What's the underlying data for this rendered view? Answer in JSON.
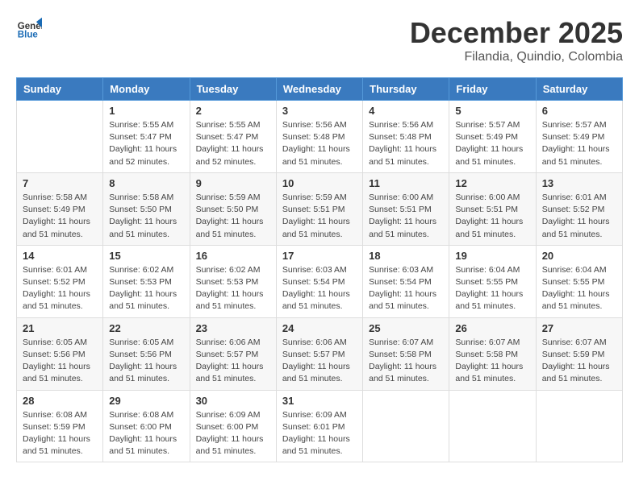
{
  "header": {
    "logo_general": "General",
    "logo_blue": "Blue",
    "month_title": "December 2025",
    "location": "Filandia, Quindio, Colombia"
  },
  "weekdays": [
    "Sunday",
    "Monday",
    "Tuesday",
    "Wednesday",
    "Thursday",
    "Friday",
    "Saturday"
  ],
  "weeks": [
    [
      {
        "day": "",
        "sunrise": "",
        "sunset": "",
        "daylight": ""
      },
      {
        "day": "1",
        "sunrise": "Sunrise: 5:55 AM",
        "sunset": "Sunset: 5:47 PM",
        "daylight": "Daylight: 11 hours and 52 minutes."
      },
      {
        "day": "2",
        "sunrise": "Sunrise: 5:55 AM",
        "sunset": "Sunset: 5:47 PM",
        "daylight": "Daylight: 11 hours and 52 minutes."
      },
      {
        "day": "3",
        "sunrise": "Sunrise: 5:56 AM",
        "sunset": "Sunset: 5:48 PM",
        "daylight": "Daylight: 11 hours and 51 minutes."
      },
      {
        "day": "4",
        "sunrise": "Sunrise: 5:56 AM",
        "sunset": "Sunset: 5:48 PM",
        "daylight": "Daylight: 11 hours and 51 minutes."
      },
      {
        "day": "5",
        "sunrise": "Sunrise: 5:57 AM",
        "sunset": "Sunset: 5:49 PM",
        "daylight": "Daylight: 11 hours and 51 minutes."
      },
      {
        "day": "6",
        "sunrise": "Sunrise: 5:57 AM",
        "sunset": "Sunset: 5:49 PM",
        "daylight": "Daylight: 11 hours and 51 minutes."
      }
    ],
    [
      {
        "day": "7",
        "sunrise": "Sunrise: 5:58 AM",
        "sunset": "Sunset: 5:49 PM",
        "daylight": "Daylight: 11 hours and 51 minutes."
      },
      {
        "day": "8",
        "sunrise": "Sunrise: 5:58 AM",
        "sunset": "Sunset: 5:50 PM",
        "daylight": "Daylight: 11 hours and 51 minutes."
      },
      {
        "day": "9",
        "sunrise": "Sunrise: 5:59 AM",
        "sunset": "Sunset: 5:50 PM",
        "daylight": "Daylight: 11 hours and 51 minutes."
      },
      {
        "day": "10",
        "sunrise": "Sunrise: 5:59 AM",
        "sunset": "Sunset: 5:51 PM",
        "daylight": "Daylight: 11 hours and 51 minutes."
      },
      {
        "day": "11",
        "sunrise": "Sunrise: 6:00 AM",
        "sunset": "Sunset: 5:51 PM",
        "daylight": "Daylight: 11 hours and 51 minutes."
      },
      {
        "day": "12",
        "sunrise": "Sunrise: 6:00 AM",
        "sunset": "Sunset: 5:51 PM",
        "daylight": "Daylight: 11 hours and 51 minutes."
      },
      {
        "day": "13",
        "sunrise": "Sunrise: 6:01 AM",
        "sunset": "Sunset: 5:52 PM",
        "daylight": "Daylight: 11 hours and 51 minutes."
      }
    ],
    [
      {
        "day": "14",
        "sunrise": "Sunrise: 6:01 AM",
        "sunset": "Sunset: 5:52 PM",
        "daylight": "Daylight: 11 hours and 51 minutes."
      },
      {
        "day": "15",
        "sunrise": "Sunrise: 6:02 AM",
        "sunset": "Sunset: 5:53 PM",
        "daylight": "Daylight: 11 hours and 51 minutes."
      },
      {
        "day": "16",
        "sunrise": "Sunrise: 6:02 AM",
        "sunset": "Sunset: 5:53 PM",
        "daylight": "Daylight: 11 hours and 51 minutes."
      },
      {
        "day": "17",
        "sunrise": "Sunrise: 6:03 AM",
        "sunset": "Sunset: 5:54 PM",
        "daylight": "Daylight: 11 hours and 51 minutes."
      },
      {
        "day": "18",
        "sunrise": "Sunrise: 6:03 AM",
        "sunset": "Sunset: 5:54 PM",
        "daylight": "Daylight: 11 hours and 51 minutes."
      },
      {
        "day": "19",
        "sunrise": "Sunrise: 6:04 AM",
        "sunset": "Sunset: 5:55 PM",
        "daylight": "Daylight: 11 hours and 51 minutes."
      },
      {
        "day": "20",
        "sunrise": "Sunrise: 6:04 AM",
        "sunset": "Sunset: 5:55 PM",
        "daylight": "Daylight: 11 hours and 51 minutes."
      }
    ],
    [
      {
        "day": "21",
        "sunrise": "Sunrise: 6:05 AM",
        "sunset": "Sunset: 5:56 PM",
        "daylight": "Daylight: 11 hours and 51 minutes."
      },
      {
        "day": "22",
        "sunrise": "Sunrise: 6:05 AM",
        "sunset": "Sunset: 5:56 PM",
        "daylight": "Daylight: 11 hours and 51 minutes."
      },
      {
        "day": "23",
        "sunrise": "Sunrise: 6:06 AM",
        "sunset": "Sunset: 5:57 PM",
        "daylight": "Daylight: 11 hours and 51 minutes."
      },
      {
        "day": "24",
        "sunrise": "Sunrise: 6:06 AM",
        "sunset": "Sunset: 5:57 PM",
        "daylight": "Daylight: 11 hours and 51 minutes."
      },
      {
        "day": "25",
        "sunrise": "Sunrise: 6:07 AM",
        "sunset": "Sunset: 5:58 PM",
        "daylight": "Daylight: 11 hours and 51 minutes."
      },
      {
        "day": "26",
        "sunrise": "Sunrise: 6:07 AM",
        "sunset": "Sunset: 5:58 PM",
        "daylight": "Daylight: 11 hours and 51 minutes."
      },
      {
        "day": "27",
        "sunrise": "Sunrise: 6:07 AM",
        "sunset": "Sunset: 5:59 PM",
        "daylight": "Daylight: 11 hours and 51 minutes."
      }
    ],
    [
      {
        "day": "28",
        "sunrise": "Sunrise: 6:08 AM",
        "sunset": "Sunset: 5:59 PM",
        "daylight": "Daylight: 11 hours and 51 minutes."
      },
      {
        "day": "29",
        "sunrise": "Sunrise: 6:08 AM",
        "sunset": "Sunset: 6:00 PM",
        "daylight": "Daylight: 11 hours and 51 minutes."
      },
      {
        "day": "30",
        "sunrise": "Sunrise: 6:09 AM",
        "sunset": "Sunset: 6:00 PM",
        "daylight": "Daylight: 11 hours and 51 minutes."
      },
      {
        "day": "31",
        "sunrise": "Sunrise: 6:09 AM",
        "sunset": "Sunset: 6:01 PM",
        "daylight": "Daylight: 11 hours and 51 minutes."
      },
      {
        "day": "",
        "sunrise": "",
        "sunset": "",
        "daylight": ""
      },
      {
        "day": "",
        "sunrise": "",
        "sunset": "",
        "daylight": ""
      },
      {
        "day": "",
        "sunrise": "",
        "sunset": "",
        "daylight": ""
      }
    ]
  ]
}
